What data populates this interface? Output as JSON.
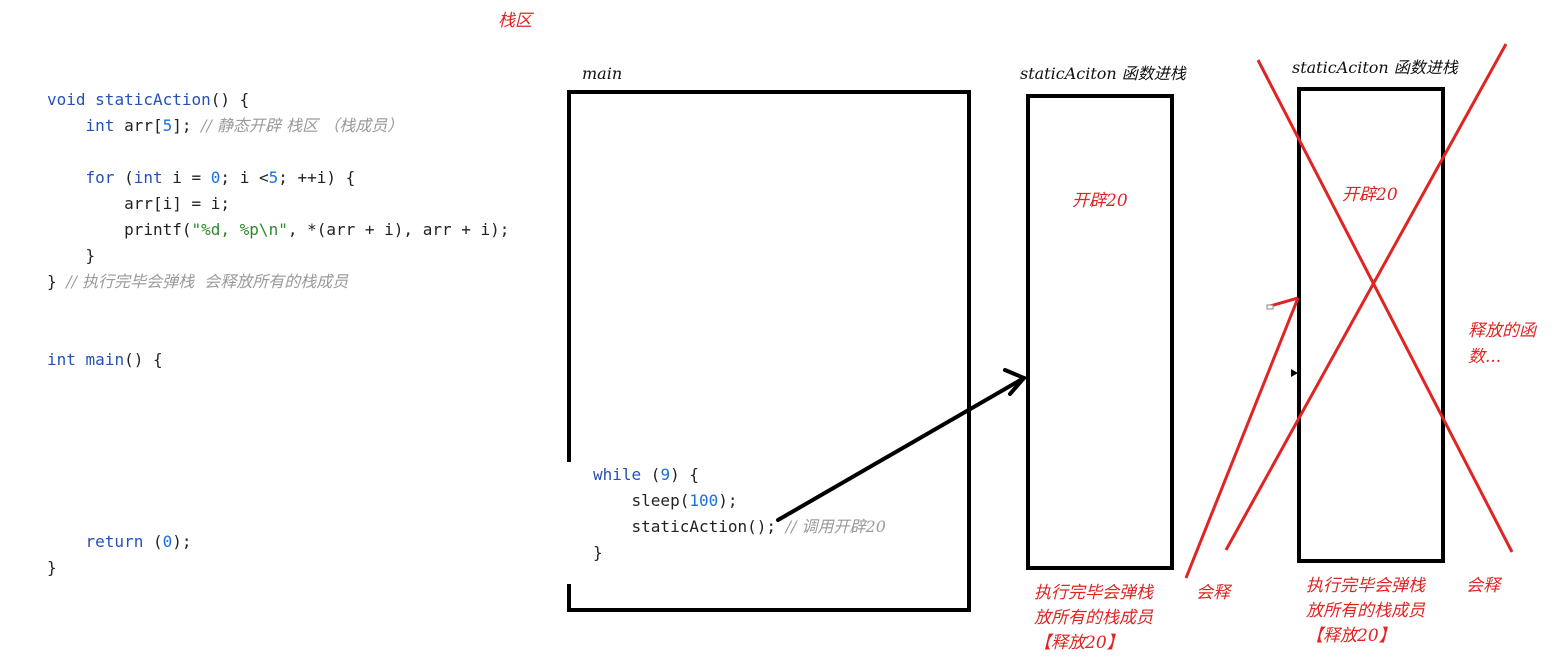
{
  "stack_area_label": "栈区",
  "code": {
    "line1": {
      "kw": "void",
      "name": "staticAction",
      "rest": "() {"
    },
    "line2": {
      "kw": "int",
      "text": "arr[",
      "num": "5",
      "after": "]; ",
      "comment": "// 静态开辟 栈区 （栈成员）"
    },
    "line4": {
      "kw": "for",
      "open": " (",
      "kw2": "int",
      "mid": " i = ",
      "num0": "0",
      "mid2": "; i <",
      "num5": "5",
      "end": "; ++i) {"
    },
    "line5": "arr[i] = i;",
    "line6": {
      "pre": "printf(",
      "str": "\"%d, %p\\n\"",
      "post": ", *(arr + i), arr + i);"
    },
    "line7": "}",
    "line8": {
      "brace": "} ",
      "comment": "// 执行完毕会弹栈  会释放所有的栈成员"
    },
    "line11": {
      "kw": "int",
      "name": "main",
      "rest": "() {"
    },
    "line18": {
      "kw": "return",
      "open": " (",
      "num": "0",
      "close": ");"
    },
    "line19": "}"
  },
  "main_box": {
    "label": "main",
    "while_kw": "while",
    "while_num": "9",
    "sleep_pre": "sleep(",
    "sleep_num": "100",
    "sleep_post": ");",
    "call": "staticAction();",
    "call_comment": "// 调用开辟20",
    "close": "}"
  },
  "frame1": {
    "label": "staticAciton 函数进栈",
    "inner_note": "开辟20",
    "below_note_line1": "执行完毕会弹栈",
    "below_note_line2": "放所有的栈成员",
    "below_note_line3": "【释放20】",
    "side_note": "会释"
  },
  "frame2": {
    "label": "staticAciton 函数进栈",
    "inner_note": "开辟20",
    "below_note_line1": "执行完毕会弹栈",
    "below_note_line2": "放所有的栈成员",
    "below_note_line3": "【释放20】",
    "side_note": "会释",
    "released_line1": "释放的函",
    "released_line2": "数..."
  },
  "colors": {
    "annotation": "#e02424",
    "keyword": "#2450b8",
    "number": "#1a6fe0",
    "string": "#2a8a2a",
    "comment": "#9a9a9a"
  }
}
